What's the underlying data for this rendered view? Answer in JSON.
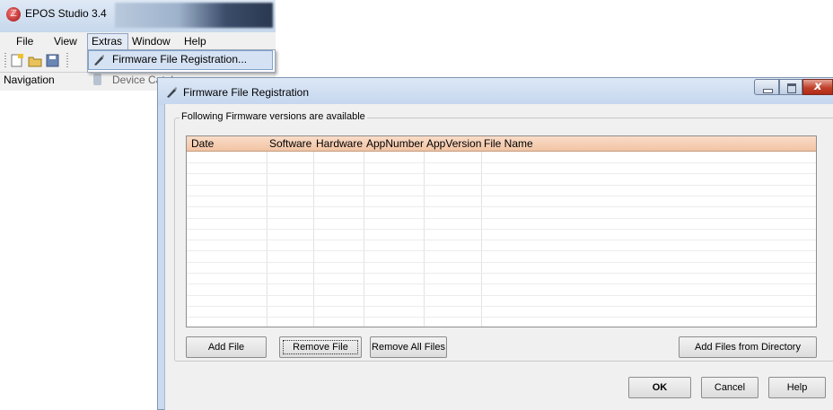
{
  "app": {
    "title": "EPOS Studio 3.4",
    "menu": [
      "File",
      "View",
      "Extras",
      "Window",
      "Help"
    ],
    "navigation_label": "Navigation",
    "device_catalog_label": "Device Catalog"
  },
  "dropdown": {
    "item_label": "Firmware File Registration..."
  },
  "dialog": {
    "title": "Firmware File Registration",
    "group_label": "Following Firmware versions are available",
    "columns": [
      "Date",
      "Software",
      "Hardware",
      "AppNumber",
      "AppVersion",
      "File Name"
    ],
    "buttons": {
      "add_file": "Add File",
      "remove_file": "Remove File",
      "remove_all_files": "Remove All Files",
      "add_from_directory": "Add Files from Directory",
      "ok": "OK",
      "cancel": "Cancel",
      "help": "Help"
    }
  },
  "colors": {
    "header_gradient_top": "#f9dcc8",
    "header_gradient_bottom": "#f2c4a4",
    "menu_highlight": "#d5e2f3"
  }
}
